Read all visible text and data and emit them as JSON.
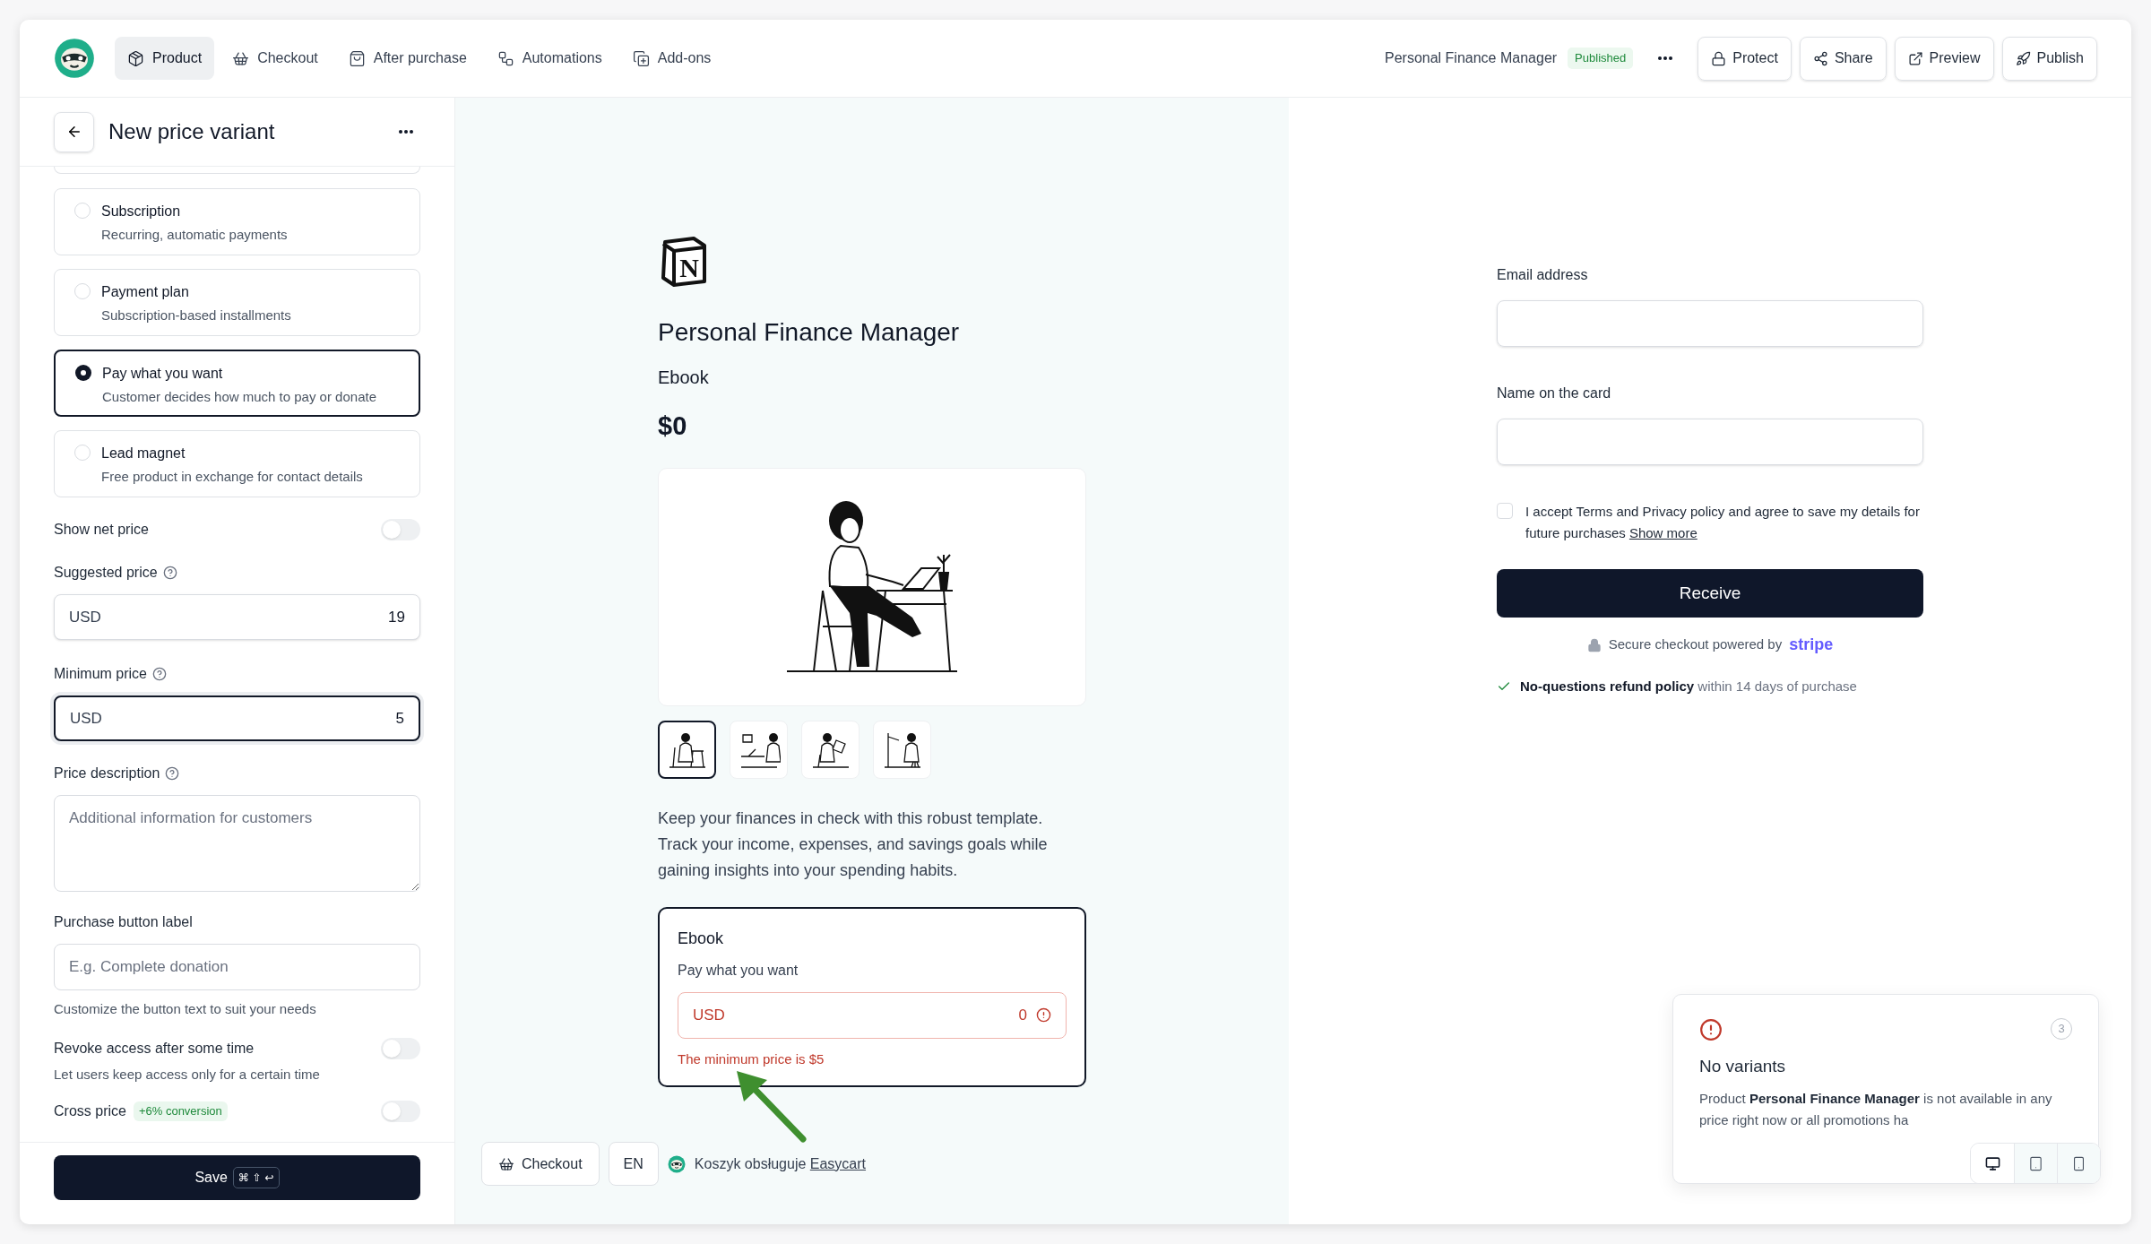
{
  "topbar": {
    "nav_tabs": [
      {
        "label": "Product",
        "selected": true
      },
      {
        "label": "Checkout",
        "selected": false
      },
      {
        "label": "After purchase",
        "selected": false
      },
      {
        "label": "Automations",
        "selected": false
      },
      {
        "label": "Add-ons",
        "selected": false
      }
    ],
    "product_name": "Personal Finance Manager",
    "status_badge": "Published",
    "actions": [
      {
        "label": "Protect"
      },
      {
        "label": "Share"
      },
      {
        "label": "Preview"
      },
      {
        "label": "Publish"
      }
    ]
  },
  "editor": {
    "title": "New price variant",
    "price_types": [
      {
        "title": "Subscription",
        "description": "Recurring, automatic payments",
        "selected": false
      },
      {
        "title": "Payment plan",
        "description": "Subscription-based installments",
        "selected": false
      },
      {
        "title": "Pay what you want",
        "description": "Customer decides how much to pay or donate",
        "selected": true
      },
      {
        "title": "Lead magnet",
        "description": "Free product in exchange for contact details",
        "selected": false
      }
    ],
    "show_net_price": {
      "label": "Show net price",
      "on": false
    },
    "suggested_price": {
      "label": "Suggested price",
      "currency": "USD",
      "value": "19",
      "focused": false
    },
    "minimum_price": {
      "label": "Minimum price",
      "currency": "USD",
      "value": "5",
      "focused": true
    },
    "price_description": {
      "label": "Price description",
      "placeholder": "Additional information for customers"
    },
    "purchase_button_label": {
      "label": "Purchase button label",
      "placeholder": "E.g. Complete donation",
      "hint": "Customize the button text to suit your needs"
    },
    "revoke_access": {
      "label": "Revoke access after some time",
      "description": "Let users keep access only for a certain time",
      "on": false
    },
    "cross_price": {
      "label": "Cross price",
      "badge": "+6% conversion",
      "on": false
    },
    "save": {
      "label": "Save",
      "shortcut": "⌘ ⇧ ↩"
    }
  },
  "preview": {
    "logo_letter": "N",
    "title": "Personal Finance Manager",
    "subtitle": "Ebook",
    "price": "$0",
    "thumbnails": [
      {
        "selected": true
      },
      {
        "selected": false
      },
      {
        "selected": false
      },
      {
        "selected": false
      }
    ],
    "description": "Keep your finances in check with this robust template. Track your income, expenses, and savings goals while gaining insights into your spending habits.",
    "variant": {
      "name": "Ebook",
      "type": "Pay what you want",
      "currency": "USD",
      "amount": "0",
      "error": "The minimum price is $5"
    },
    "footer": {
      "checkout_button": "Checkout",
      "language": "EN",
      "powered_by": "Koszyk obsługuje",
      "powered_by_link": "Easycart"
    }
  },
  "checkout_form": {
    "fields": [
      {
        "label": "Email address"
      },
      {
        "label": "Name on the card"
      }
    ],
    "consent": {
      "text": "I accept Terms and Privacy policy and agree to save my details for future purchases",
      "link": "Show more",
      "checked": false
    },
    "submit": "Receive",
    "secure_note": "Secure checkout powered by",
    "payment_brand": "stripe",
    "refund_policy": "**No-questions refund policy** within 14 days of purchase"
  },
  "toast": {
    "title": "No variants",
    "message": "Product **Personal Finance Manager** is not available in any price right now or all promotions ha",
    "count": "3"
  },
  "device_switcher": [
    {
      "kind": "desktop",
      "selected": true
    },
    {
      "kind": "tablet",
      "selected": false
    },
    {
      "kind": "mobile",
      "selected": false
    }
  ]
}
